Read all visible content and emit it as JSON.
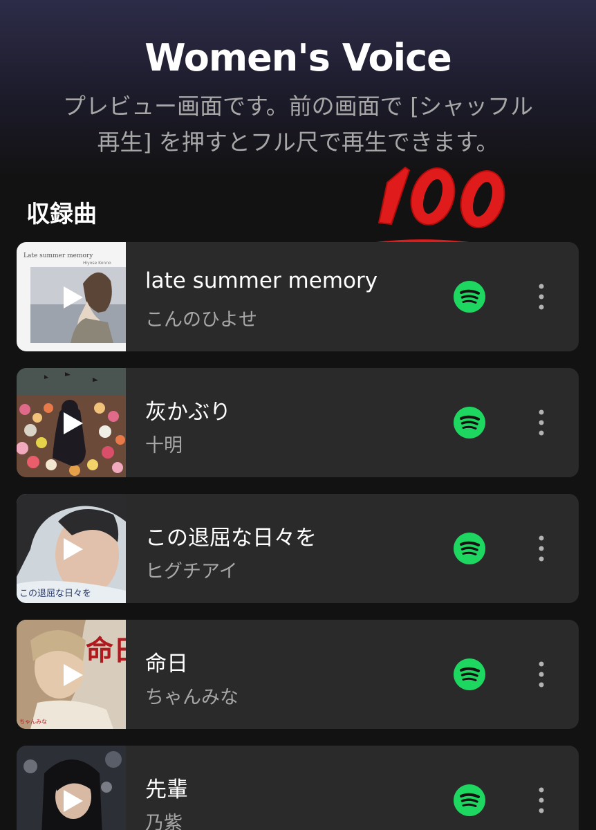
{
  "header": {
    "title": "Women's Voice",
    "subtitle": "プレビュー画面です。前の画面で [シャッフル再生] を押すとフル尺で再生できます。"
  },
  "section": {
    "label": "収録曲"
  },
  "overlay": {
    "emoji": "hundred-points-emoji"
  },
  "colors": {
    "background": "#121212",
    "card": "#2a2a2a",
    "secondary_text": "#a7a7a7",
    "spotify_green": "#1ed760",
    "emoji_red": "#e01b1b"
  },
  "tracks": [
    {
      "title": "late summer memory",
      "artist": "こんのひよせ",
      "cover_text": "Late summer memory",
      "cover_text_2": "Hiyose Konno"
    },
    {
      "title": "灰かぶり",
      "artist": "十明"
    },
    {
      "title": "この退屈な日々を",
      "artist": "ヒグチアイ",
      "cover_text": "この退屈な日々を"
    },
    {
      "title": "命日",
      "artist": "ちゃんみな",
      "cover_text": "命日",
      "cover_text_2": "ちゃんみな"
    },
    {
      "title": "先輩",
      "artist": "乃紫"
    }
  ]
}
